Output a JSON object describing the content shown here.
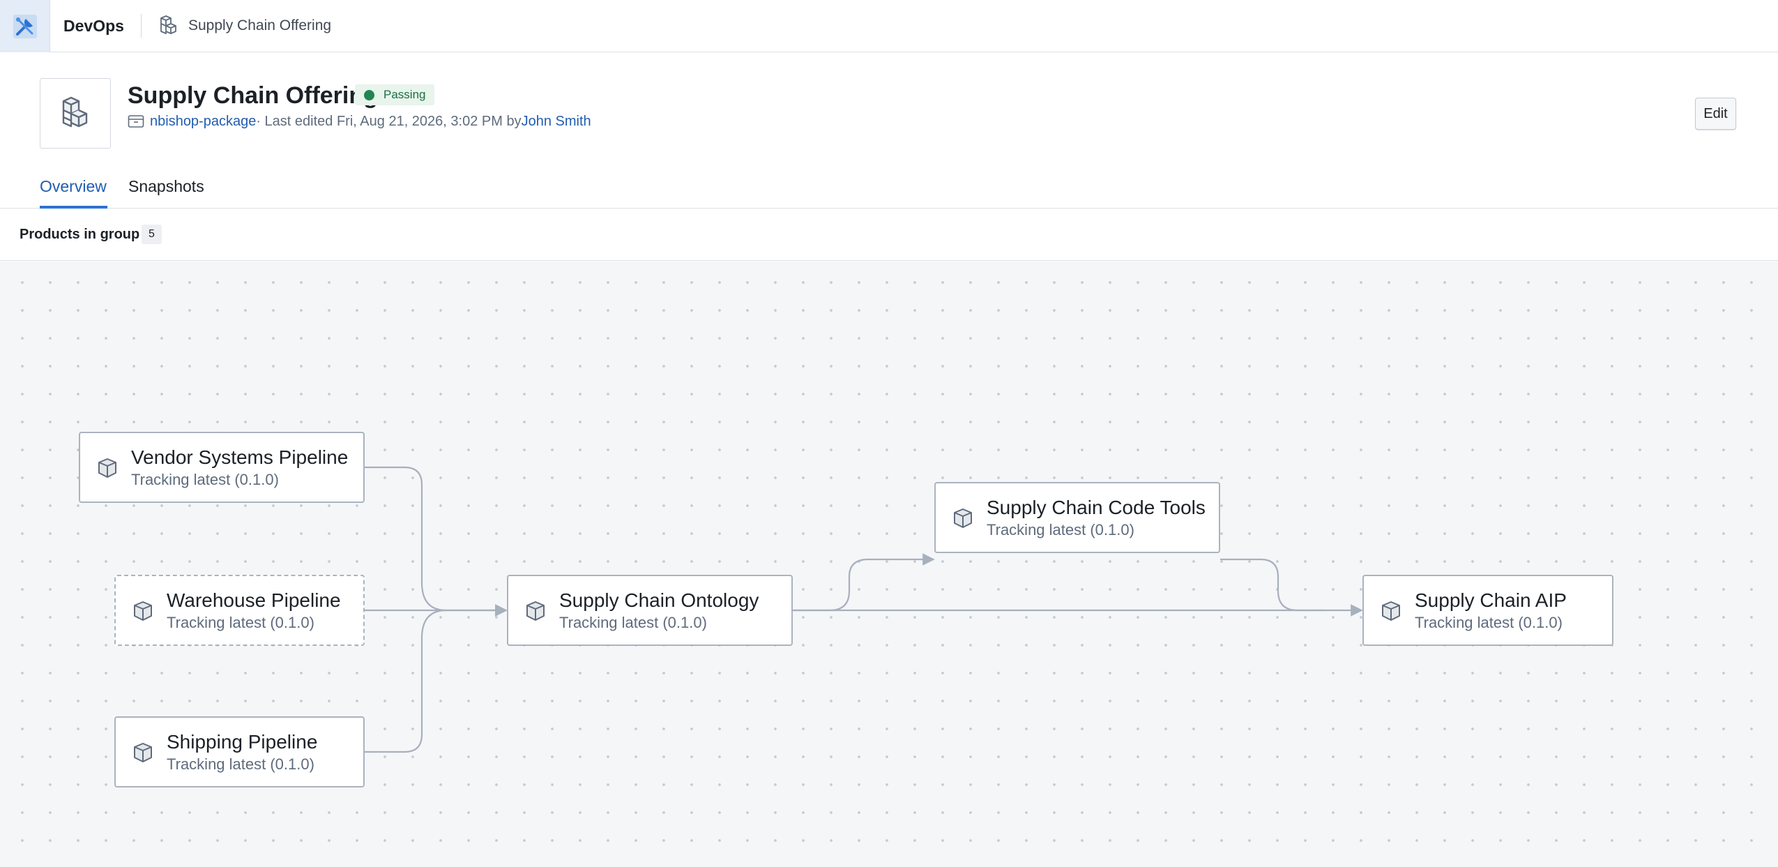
{
  "app": {
    "name": "DevOps",
    "logo_icon": "devops-tools-icon"
  },
  "breadcrumb": {
    "icon": "cubes-icon",
    "label": "Supply Chain Offering"
  },
  "header": {
    "title": "Supply Chain Offering",
    "status": "Passing",
    "status_color": "#238551",
    "package_icon": "package-icon",
    "package_link": "nbishop-package",
    "edited_text": " · Last edited Fri, Aug 21, 2026, 3:02 PM by ",
    "author": "John Smith",
    "edit_label": "Edit"
  },
  "tabs": [
    {
      "label": "Overview",
      "active": true
    },
    {
      "label": "Snapshots",
      "active": false
    }
  ],
  "products": {
    "label": "Products in group",
    "count": "5"
  },
  "graph": {
    "nodes": [
      {
        "id": "vendor",
        "title": "Vendor Systems Pipeline",
        "subtitle": "Tracking latest (0.1.0)",
        "dashed": false
      },
      {
        "id": "warehouse",
        "title": "Warehouse Pipeline",
        "subtitle": "Tracking latest (0.1.0)",
        "dashed": true
      },
      {
        "id": "shipping",
        "title": "Shipping Pipeline",
        "subtitle": "Tracking latest (0.1.0)",
        "dashed": false
      },
      {
        "id": "ontology",
        "title": "Supply Chain Ontology",
        "subtitle": "Tracking latest (0.1.0)",
        "dashed": false
      },
      {
        "id": "codetools",
        "title": "Supply Chain Code Tools",
        "subtitle": "Tracking latest (0.1.0)",
        "dashed": false
      },
      {
        "id": "aip",
        "title": "Supply Chain AIP",
        "subtitle": "Tracking latest (0.1.0)",
        "dashed": false
      }
    ],
    "edges": [
      {
        "from": "vendor",
        "to": "ontology"
      },
      {
        "from": "warehouse",
        "to": "ontology"
      },
      {
        "from": "shipping",
        "to": "ontology"
      },
      {
        "from": "ontology",
        "to": "codetools"
      },
      {
        "from": "ontology",
        "to": "aip"
      },
      {
        "from": "codetools",
        "to": "aip"
      }
    ],
    "edge_color": "#a7b0bd",
    "node_icon": "cube-icon"
  }
}
